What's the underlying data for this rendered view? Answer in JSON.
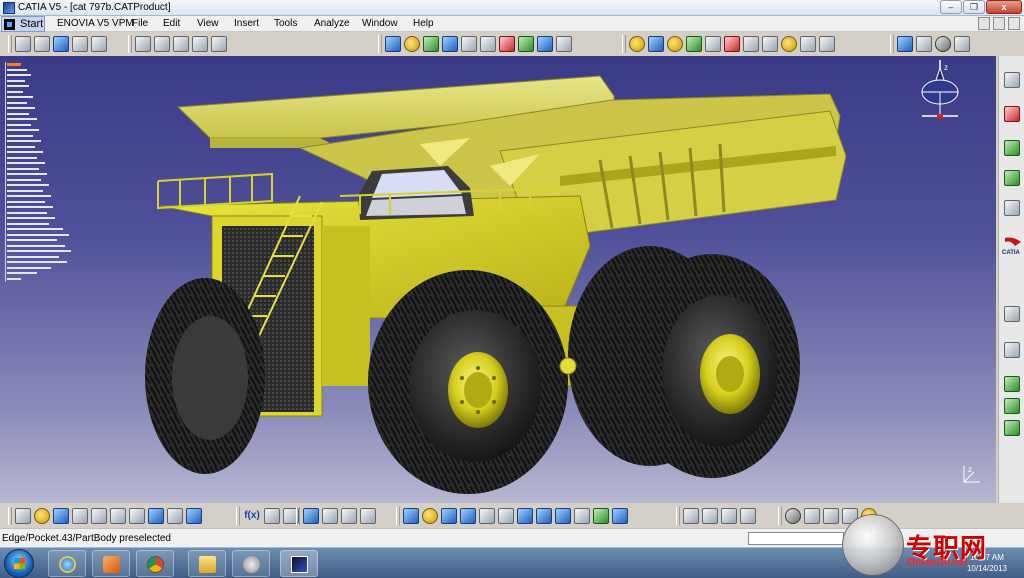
{
  "window": {
    "title": "CATIA V5 - [cat 797b.CATProduct]",
    "min_label": "–",
    "restore_label": "❒",
    "close_label": "x"
  },
  "menubar": {
    "items": [
      "Start",
      "ENOVIA V5 VPM",
      "File",
      "Edit",
      "View",
      "Insert",
      "Tools",
      "Analyze",
      "Window",
      "Help"
    ]
  },
  "toolbar_bottom": {
    "formula_label": "f(x)"
  },
  "compass": {
    "axis_label": "z"
  },
  "viewport": {
    "axis_label": "z"
  },
  "vtoolbar": {
    "logo_text": "CATIA"
  },
  "statusbar": {
    "message": "Edge/Pocket.43/PartBody preselected",
    "command_value": ""
  },
  "taskbar": {
    "apps": [
      "windows-explorer",
      "internet-explorer",
      "media-player",
      "chrome",
      "file-folder",
      "drive-tool",
      "catia"
    ]
  },
  "tray": {
    "time": "10:37 AM",
    "date": "10/14/2013"
  },
  "watermark": {
    "text": "专职网",
    "url": "Zhuanzhi.net"
  },
  "colors": {
    "viewport_top": "#3a3a86",
    "viewport_bottom": "#b7b7d2",
    "truck_yellow": "#d6d23a",
    "tire": "#2e2e2e",
    "accent": "#ff7a1a"
  }
}
